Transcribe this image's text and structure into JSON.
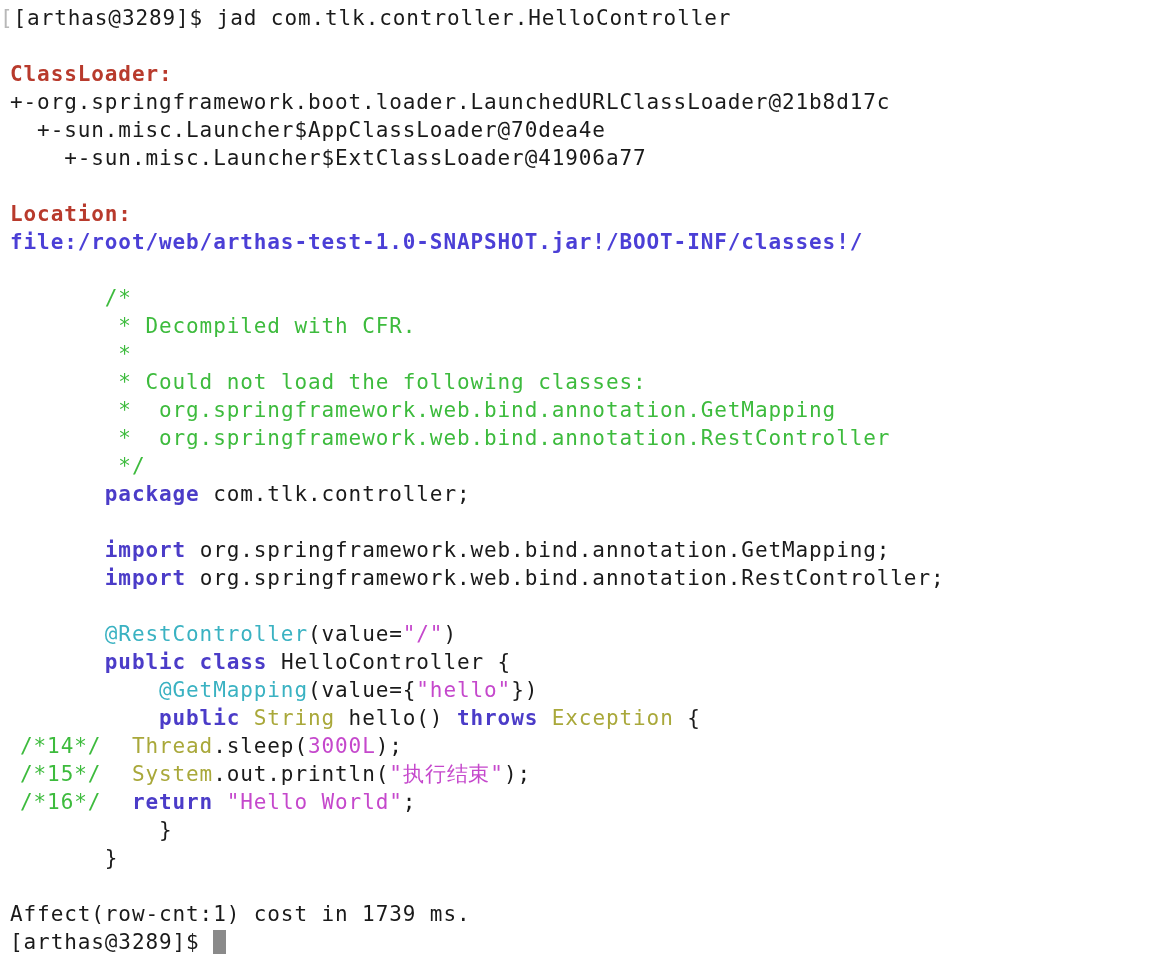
{
  "terminal": {
    "blocks": [
      [
        {
          "segments": [
            {
              "kind": "dim",
              "text": "["
            },
            {
              "kind": "plain",
              "text": "[arthas@3289]$ jad com.tlk.controller.HelloController"
            }
          ]
        }
      ],
      [
        {
          "segments": [
            {
              "kind": "label",
              "text": "ClassLoader:"
            }
          ]
        },
        {
          "segments": [
            {
              "kind": "plain",
              "text": "+-org.springframework.boot.loader.LaunchedURLClassLoader@21b8d17c"
            }
          ]
        },
        {
          "segments": [
            {
              "kind": "plain",
              "text": "  +-sun.misc.Launcher$AppClassLoader@70dea4e"
            }
          ]
        },
        {
          "segments": [
            {
              "kind": "plain",
              "text": "    +-sun.misc.Launcher$ExtClassLoader@41906a77"
            }
          ]
        }
      ],
      [
        {
          "segments": [
            {
              "kind": "label",
              "text": "Location:"
            }
          ]
        },
        {
          "segments": [
            {
              "kind": "path",
              "text": "file:/root/web/arthas-test-1.0-SNAPSHOT.jar!/BOOT-INF/classes!/"
            }
          ]
        }
      ],
      [
        {
          "segments": [
            {
              "kind": "comment",
              "text": "       /*"
            }
          ]
        },
        {
          "segments": [
            {
              "kind": "comment",
              "text": "        * Decompiled with CFR."
            }
          ]
        },
        {
          "segments": [
            {
              "kind": "comment",
              "text": "        *"
            }
          ]
        },
        {
          "segments": [
            {
              "kind": "comment",
              "text": "        * Could not load the following classes:"
            }
          ]
        },
        {
          "segments": [
            {
              "kind": "comment",
              "text": "        *  org.springframework.web.bind.annotation.GetMapping"
            }
          ]
        },
        {
          "segments": [
            {
              "kind": "comment",
              "text": "        *  org.springframework.web.bind.annotation.RestController"
            }
          ]
        },
        {
          "segments": [
            {
              "kind": "comment",
              "text": "        */"
            }
          ]
        },
        {
          "segments": [
            {
              "kind": "keyword",
              "text": "       package"
            },
            {
              "kind": "plain",
              "text": " com.tlk.controller;"
            }
          ]
        }
      ],
      [
        {
          "segments": [
            {
              "kind": "keyword",
              "text": "       import"
            },
            {
              "kind": "plain",
              "text": " org.springframework.web.bind.annotation.GetMapping;"
            }
          ]
        },
        {
          "segments": [
            {
              "kind": "keyword",
              "text": "       import"
            },
            {
              "kind": "plain",
              "text": " org.springframework.web.bind.annotation.RestController;"
            }
          ]
        }
      ],
      [
        {
          "segments": [
            {
              "kind": "annotation",
              "text": "       @RestController"
            },
            {
              "kind": "plain",
              "text": "(value="
            },
            {
              "kind": "string",
              "text": "\"/\""
            },
            {
              "kind": "plain",
              "text": ")"
            }
          ]
        },
        {
          "segments": [
            {
              "kind": "keyword",
              "text": "       public class"
            },
            {
              "kind": "plain",
              "text": " HelloController {"
            }
          ]
        },
        {
          "segments": [
            {
              "kind": "annotation",
              "text": "           @GetMapping"
            },
            {
              "kind": "plain",
              "text": "(value={"
            },
            {
              "kind": "string",
              "text": "\"hello\""
            },
            {
              "kind": "plain",
              "text": "})"
            }
          ]
        },
        {
          "segments": [
            {
              "kind": "keyword",
              "text": "           public"
            },
            {
              "kind": "type",
              "text": " String"
            },
            {
              "kind": "plain",
              "text": " hello()"
            },
            {
              "kind": "keyword",
              "text": " throws"
            },
            {
              "kind": "type",
              "text": " Exception"
            },
            {
              "kind": "plain",
              "text": " {"
            }
          ]
        },
        {
          "gutter": "/*14*/",
          "segments": [
            {
              "kind": "type",
              "text": "         Thread"
            },
            {
              "kind": "plain",
              "text": ".sleep("
            },
            {
              "kind": "string",
              "text": "3000L"
            },
            {
              "kind": "plain",
              "text": ");"
            }
          ]
        },
        {
          "gutter": "/*15*/",
          "segments": [
            {
              "kind": "type",
              "text": "         System"
            },
            {
              "kind": "plain",
              "text": ".out.println("
            },
            {
              "kind": "string",
              "text": "\"执行结束\""
            },
            {
              "kind": "plain",
              "text": ");"
            }
          ]
        },
        {
          "gutter": "/*16*/",
          "segments": [
            {
              "kind": "keyword",
              "text": "         return"
            },
            {
              "kind": "string",
              "text": " \"Hello World\""
            },
            {
              "kind": "plain",
              "text": ";"
            }
          ]
        },
        {
          "segments": [
            {
              "kind": "plain",
              "text": "           }"
            }
          ]
        },
        {
          "segments": [
            {
              "kind": "plain",
              "text": "       }"
            }
          ]
        }
      ],
      [
        {
          "segments": [
            {
              "kind": "plain",
              "text": "Affect(row-cnt:1) cost in 1739 ms."
            }
          ]
        },
        {
          "segments": [
            {
              "kind": "plain",
              "text": "[arthas@3289]$"
            }
          ],
          "cursor": true
        }
      ]
    ]
  }
}
